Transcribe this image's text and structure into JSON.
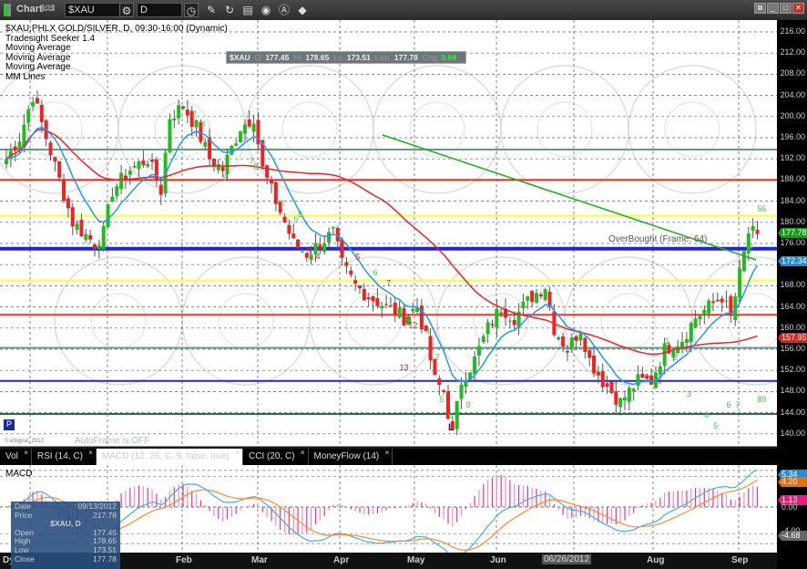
{
  "toolbar": {
    "title": "Chart",
    "link_badge": "5|1",
    "symbol": "$XAU",
    "interval": "D"
  },
  "legend": {
    "line1": "$XAU,PHLX GOLD/SILVER, D, 09:30-16:00 (Dynamic)",
    "line2": "Tradesight Seeker 1.4",
    "line3": "Moving Average",
    "line4": "Moving Average",
    "line5": "Moving Average",
    "line6": "MM Lines"
  },
  "quote": {
    "symbol": "$XAU",
    "o_label": "O",
    "open": "177.45",
    "h_label": "Hi",
    "high": "178.65",
    "l_label": "Lo",
    "low": "173.51",
    "last_label": "Last",
    "last": "177.78",
    "chg_label": "Chg",
    "chg": "0.64"
  },
  "annotations": {
    "overbought": "OverBought (Frame: 64)",
    "autoframe": "AutoFrame is OFF",
    "copyright": "© eSignal, 2012",
    "p_marker": "P",
    "low_marker": "L"
  },
  "price_axis": {
    "ticks": [
      "216.00",
      "212.00",
      "208.00",
      "204.00",
      "200.00",
      "196.00",
      "192.00",
      "188.00",
      "184.00",
      "180.00",
      "176.00",
      "172.00",
      "168.00",
      "164.00",
      "160.00",
      "156.00",
      "152.00",
      "148.00",
      "144.00",
      "140.00"
    ],
    "last_badge": "177.78",
    "ma_badge": "172.34",
    "ma2_badge": "157.95"
  },
  "tabs": [
    {
      "label": "Vol"
    },
    {
      "label": "RSI (14, C)"
    },
    {
      "label": "MACD (12, 26, C, 9, false, true)"
    },
    {
      "label": "CCI (20, C)"
    },
    {
      "label": "MoneyFlow (14)"
    }
  ],
  "macd": {
    "title": "MACD",
    "badge_macd": "5.34",
    "badge_signal": "4.20",
    "badge_hist": "1.13",
    "zero": "0.00",
    "neg_tick": "-4.00",
    "badge_low": "-4.68"
  },
  "dates": {
    "cut": "Dy",
    "feb": "Feb",
    "mar": "Mar",
    "apr": "Apr",
    "may": "May",
    "jun": "Jun",
    "crosshair": "06/26/2012",
    "aug": "Aug",
    "sep": "Sep"
  },
  "tooltip": {
    "date_label": "Date",
    "date": "09/13/2012",
    "price_label": "Price",
    "price": "217.78",
    "symbol": "$XAU, D",
    "open_label": "Open",
    "open": "177.45",
    "high_label": "High",
    "high": "178.65",
    "low_label": "Low",
    "low": "173.51",
    "close_label": "Close",
    "close": "177.78"
  },
  "colors": {
    "up": "#22bb22",
    "down": "#ee2222",
    "ma_fast": "#2299ee",
    "ma_mid": "#ee2222",
    "ma_slow": "#22aa22"
  },
  "chart_data": {
    "type": "candlestick",
    "price_range": [
      137,
      218
    ],
    "keypoints": [
      [
        0,
        192
      ],
      [
        3,
        196
      ],
      [
        6,
        204
      ],
      [
        9,
        196
      ],
      [
        12,
        188
      ],
      [
        15,
        180
      ],
      [
        20,
        176
      ],
      [
        22,
        178
      ],
      [
        24,
        186
      ],
      [
        28,
        190
      ],
      [
        32,
        192
      ],
      [
        35,
        186
      ],
      [
        37,
        200
      ],
      [
        40,
        202
      ],
      [
        43,
        198
      ],
      [
        46,
        192
      ],
      [
        49,
        190
      ],
      [
        53,
        198
      ],
      [
        56,
        200
      ],
      [
        58,
        190
      ],
      [
        61,
        184
      ],
      [
        63,
        180
      ],
      [
        65,
        176
      ],
      [
        68,
        174
      ],
      [
        71,
        176
      ],
      [
        74,
        178
      ],
      [
        76,
        172
      ],
      [
        79,
        168
      ],
      [
        82,
        166
      ],
      [
        86,
        164
      ],
      [
        90,
        162
      ],
      [
        93,
        164
      ],
      [
        95,
        158
      ],
      [
        97,
        150
      ],
      [
        99,
        148
      ],
      [
        101,
        140
      ],
      [
        103,
        150
      ],
      [
        106,
        154
      ],
      [
        109,
        160
      ],
      [
        112,
        164
      ],
      [
        115,
        162
      ],
      [
        119,
        166
      ],
      [
        122,
        168
      ],
      [
        124,
        160
      ],
      [
        127,
        156
      ],
      [
        130,
        160
      ],
      [
        132,
        154
      ],
      [
        135,
        150
      ],
      [
        139,
        146
      ],
      [
        143,
        150
      ],
      [
        146,
        150
      ],
      [
        149,
        156
      ],
      [
        153,
        158
      ],
      [
        156,
        162
      ],
      [
        159,
        164
      ],
      [
        162,
        166
      ],
      [
        164,
        162
      ],
      [
        166,
        170
      ],
      [
        168,
        178
      ],
      [
        170,
        177.78
      ]
    ],
    "levels": [
      {
        "price": 193.75,
        "color": "#669988"
      },
      {
        "price": 188,
        "color": "#ee2222"
      },
      {
        "price": 181.25,
        "color": "#ffff33"
      },
      {
        "price": 175,
        "color": "#2222dd"
      },
      {
        "price": 169,
        "color": "#ffff33"
      },
      {
        "price": 162.5,
        "color": "#ee3333"
      },
      {
        "price": 156.25,
        "color": "#669988"
      },
      {
        "price": 150,
        "color": "#2222dd"
      },
      {
        "price": 143.75,
        "color": "#336655"
      },
      {
        "price": 137.5,
        "color": "#ee2222"
      }
    ],
    "seeker_labels": [
      [
        "2",
        42,
        200
      ],
      [
        "3",
        44,
        198
      ],
      [
        "7",
        55,
        191
      ],
      [
        "8",
        56,
        190
      ],
      [
        "9",
        49,
        188
      ],
      [
        "5",
        62,
        183
      ],
      [
        "8",
        66,
        181
      ],
      [
        "9",
        65,
        180
      ],
      [
        "3",
        68,
        174
      ],
      [
        "4",
        70,
        173
      ],
      [
        "5",
        79,
        173
      ],
      [
        "6",
        83,
        170
      ],
      [
        "7",
        86,
        168
      ],
      [
        "11",
        90,
        161
      ],
      [
        "12",
        91,
        160
      ],
      [
        "13",
        89,
        152
      ],
      [
        "1",
        95,
        159
      ],
      [
        "2",
        97,
        154
      ],
      [
        "5",
        98,
        146
      ],
      [
        "6",
        100,
        143
      ],
      [
        "9",
        104,
        145
      ],
      [
        "1",
        149,
        157
      ],
      [
        "2",
        151,
        154
      ],
      [
        "3",
        154,
        147
      ],
      [
        "4",
        158,
        143
      ],
      [
        "5",
        160,
        141
      ],
      [
        "6",
        163,
        145
      ],
      [
        "7",
        165,
        145
      ],
      [
        "8",
        170,
        146
      ],
      [
        "9",
        171,
        146
      ],
      [
        "4",
        168,
        175
      ],
      [
        "5",
        170,
        182
      ],
      [
        "6",
        171,
        182
      ]
    ]
  }
}
